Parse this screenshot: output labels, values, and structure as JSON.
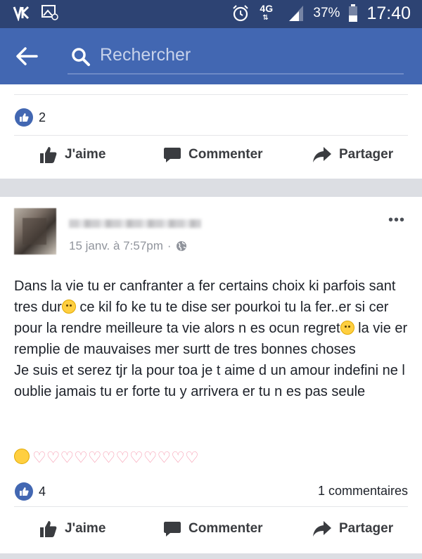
{
  "status_bar": {
    "network": "4G",
    "battery_pct": "37%",
    "time": "17:40"
  },
  "header": {
    "search_placeholder": "Rechercher"
  },
  "post1": {
    "like_count": "2",
    "actions": {
      "like": "J'aime",
      "comment": "Commenter",
      "share": "Partager"
    }
  },
  "post2": {
    "date": "15 janv. à 7:57pm",
    "text_lines": [
      "Dans la vie tu er canfranter a  fer certains choix ki parfois sant tres dur",
      "ce kil fo ke tu te dise ser pourkoi tu la fer..er si cer pour la rendre meilleure ta vie alors n es ocun regret",
      "la vie er remplie de mauvaises mer surtt de tres bonnes choses",
      "Je suis et serez tjr la pour toa je t aime d un amour indefini ne l oublie jamais tu er forte tu y arrivera er tu n es pas seule"
    ],
    "hearts": "♡♡♡♡♡♡♡♡♡♡♡♡",
    "like_count": "4",
    "comments_count": "1 commentaires",
    "actions": {
      "like": "J'aime",
      "comment": "Commenter",
      "share": "Partager"
    }
  },
  "colors": {
    "status_bar": "#2d4373",
    "app_bar": "#4267b2",
    "feed_bg": "#dcdee3"
  }
}
